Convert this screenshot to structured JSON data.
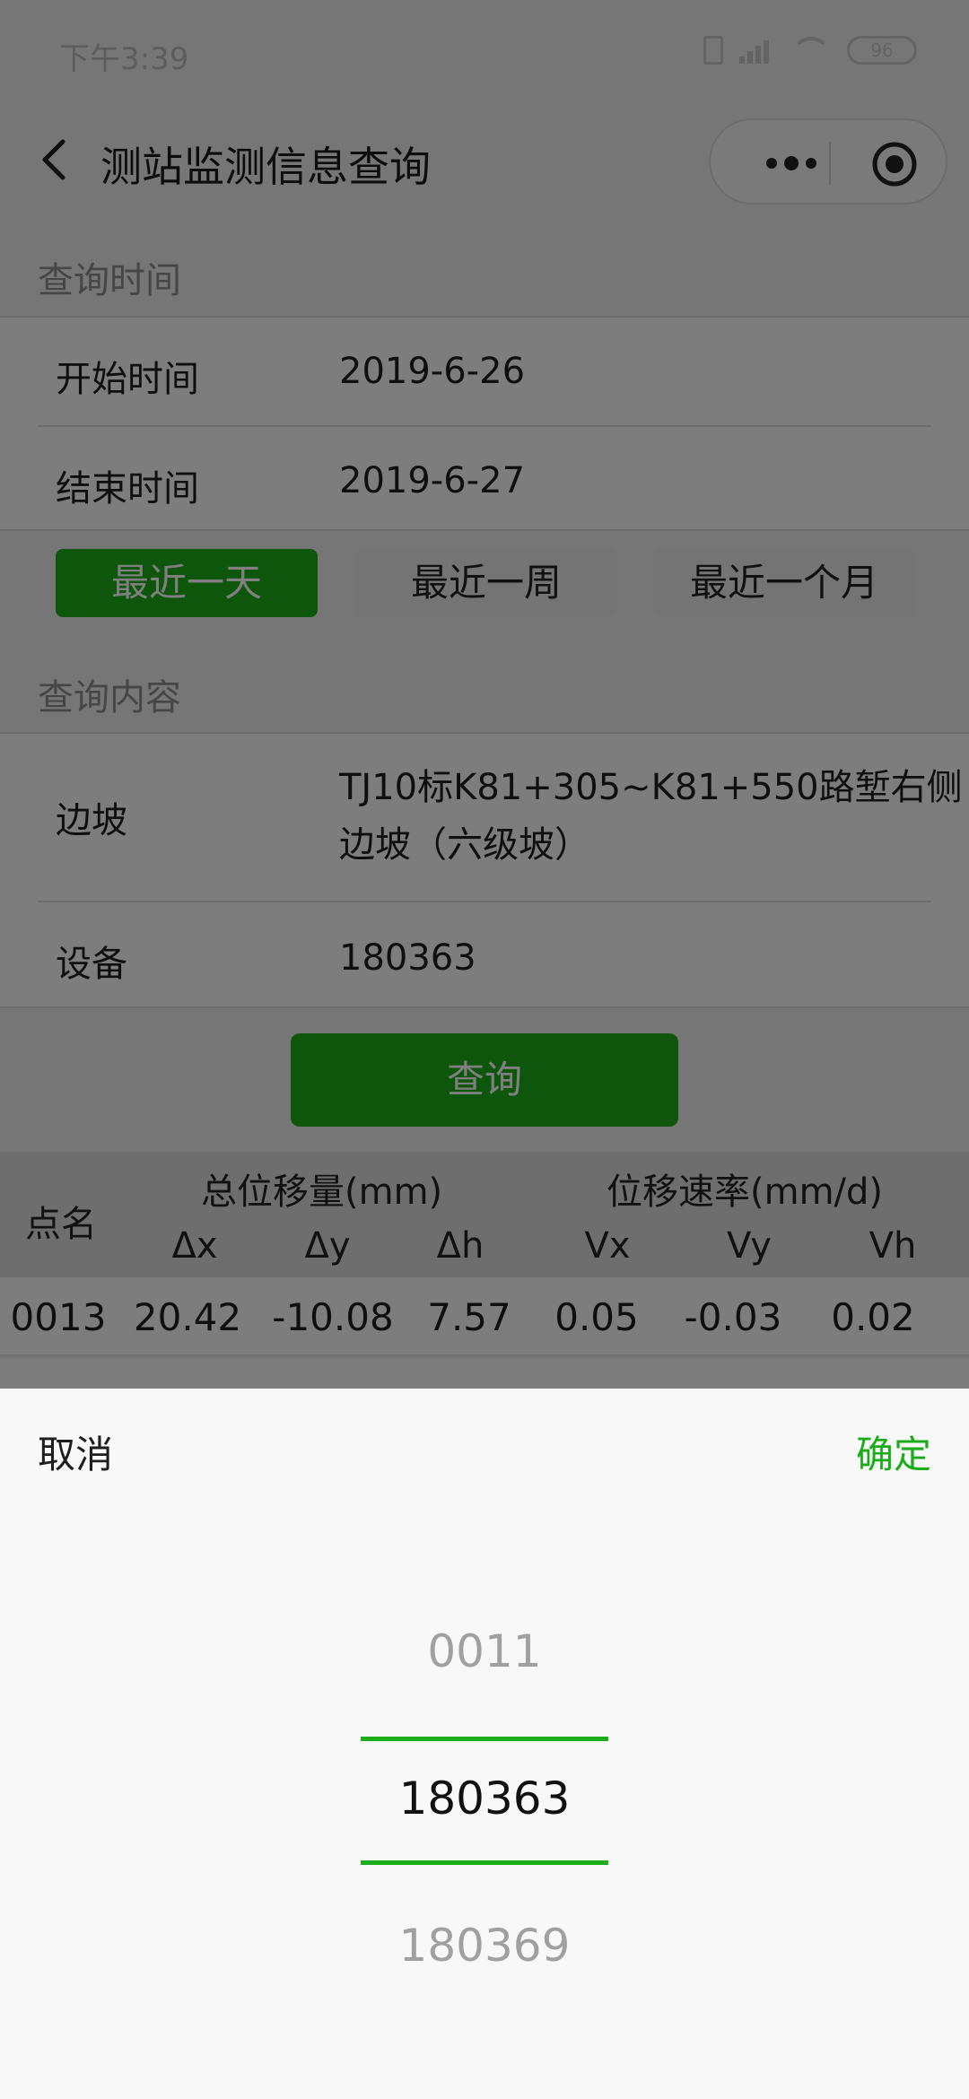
{
  "status_bar": {
    "time": "下午3:39",
    "battery": "96"
  },
  "nav": {
    "title": "测站监测信息查询"
  },
  "time_section": {
    "label": "查询时间",
    "start_label": "开始时间",
    "start_value": "2019-6-26",
    "end_label": "结束时间",
    "end_value": "2019-6-27"
  },
  "range_buttons": [
    "最近一天",
    "最近一周",
    "最近一个月"
  ],
  "content_section": {
    "label": "查询内容",
    "slope_label": "边坡",
    "slope_value": "TJ10标K81+305~K81+550路堑右侧边坡（六级坡）",
    "device_label": "设备",
    "device_value": "180363"
  },
  "query_button": "查询",
  "table": {
    "col_point": "点名",
    "group_total": "总位移量(mm)",
    "group_rate": "位移速率(mm/d)",
    "sub_headers": [
      "Δx",
      "Δy",
      "Δh",
      "Vx",
      "Vy",
      "Vh"
    ],
    "rows": [
      [
        "0013",
        "20.42",
        "-10.08",
        "7.57",
        "0.05",
        "-0.03",
        "0.02"
      ]
    ]
  },
  "picker": {
    "cancel": "取消",
    "confirm": "确定",
    "options": [
      "0011",
      "180363",
      "180369"
    ]
  },
  "colors": {
    "accent": "#1aad19",
    "background": "#ededed"
  }
}
